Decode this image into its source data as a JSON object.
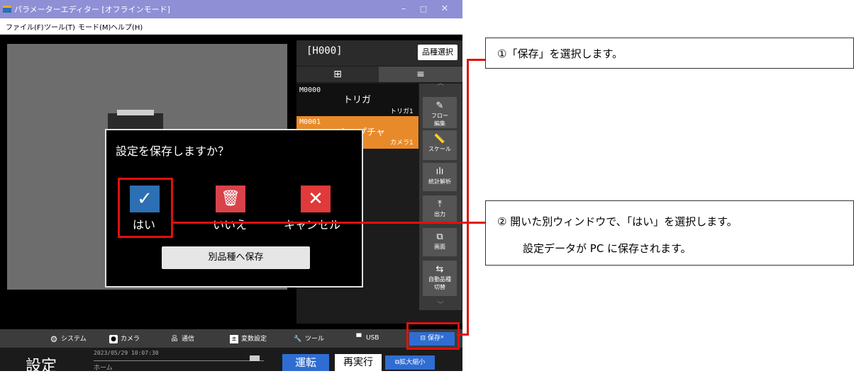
{
  "window": {
    "title": "パラメーターエディター [オフラインモード]",
    "minimize": "–",
    "maximize": "□",
    "close": "✕"
  },
  "menu": [
    "ファイル(F)",
    "ツール(T)",
    "モード(M)",
    "ヘルプ(H)"
  ],
  "panel": {
    "product": "[H000]",
    "select_button": "品種選択",
    "tab_grid_icon": "grid-icon",
    "tab_list_icon": "list-icon",
    "flows": [
      {
        "id": "M0000",
        "name": "トリガ",
        "sub": "トリガ1"
      },
      {
        "id": "M0001",
        "name": "キャプチャ",
        "sub": "カメラ1"
      }
    ],
    "tools": [
      {
        "icon": "pencil-icon",
        "label1": "フロー",
        "label2": "編集"
      },
      {
        "icon": "ruler-icon",
        "label1": "スケール",
        "label2": ""
      },
      {
        "icon": "bar-chart-icon",
        "label1": "統計解析",
        "label2": ""
      },
      {
        "icon": "export-icon",
        "label1": "出力",
        "label2": ""
      },
      {
        "icon": "screen-icon",
        "label1": "画面",
        "label2": ""
      },
      {
        "icon": "auto-switch-icon",
        "label1": "自動品種",
        "label2": "切替"
      }
    ]
  },
  "bottombar": {
    "items": [
      "システム",
      "カメラ",
      "通信",
      "変数設定",
      "ツール",
      "USB"
    ],
    "save": "保存*"
  },
  "status": {
    "mode": "設定",
    "datetime": "2023/05/29 10:07:30",
    "location": "ホーム",
    "run": "運転",
    "rerun": "再実行",
    "zoom": "拡大縮小"
  },
  "dialog": {
    "question": "設定を保存しますか？",
    "yes": "はい",
    "no": "いいえ",
    "cancel": "キャンセル",
    "save_as": "別品種へ保存"
  },
  "callouts": {
    "step1": "①「保存」を選択します。",
    "step2_line1": "② 開いた別ウィンドウで、「はい」を選択します。",
    "step2_line2": "設定データが PC に保存されます。"
  },
  "colors": {
    "highlight": "#e01010",
    "accent_blue": "#2f6dd2",
    "flow_orange": "#e98a2a",
    "yes_blue": "#2c6fb2",
    "no_red": "#d8434a",
    "cancel_red": "#e03a3a"
  }
}
